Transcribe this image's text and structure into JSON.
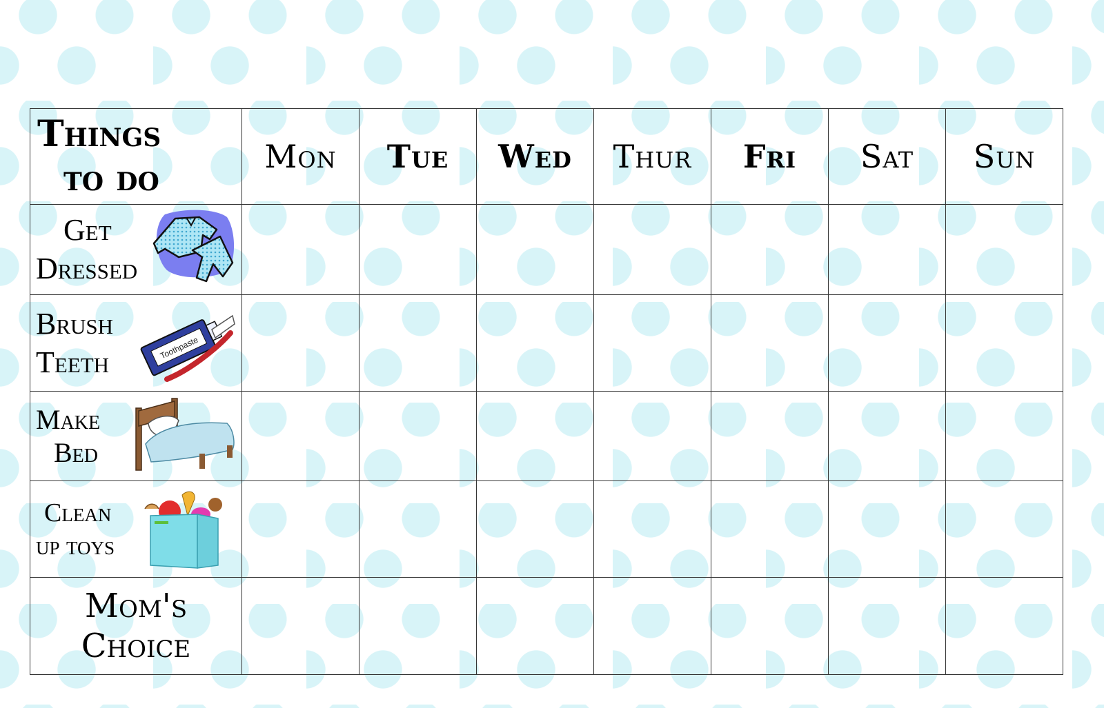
{
  "header": {
    "corner_line1": "Things",
    "corner_line2": "to do",
    "days": [
      "Mon",
      "Tue",
      "Wed",
      "Thur",
      "Fri",
      "Sat",
      "Sun"
    ]
  },
  "tasks": [
    {
      "line1": "Get",
      "line2": "Dressed",
      "icon": "pajamas-icon"
    },
    {
      "line1": "Brush",
      "line2": "Teeth",
      "icon": "toothpaste-toothbrush-icon",
      "icon_text": "Toothpaste"
    },
    {
      "line1": "Make",
      "line2": "Bed",
      "icon": "bed-icon"
    },
    {
      "line1": "Clean",
      "line2": "up toys",
      "icon": "toy-box-icon"
    },
    {
      "line1": "Mom's",
      "line2": "Choice"
    }
  ],
  "colors": {
    "dot": "#d8f4f8",
    "grid": "#333333",
    "text": "#000000"
  }
}
